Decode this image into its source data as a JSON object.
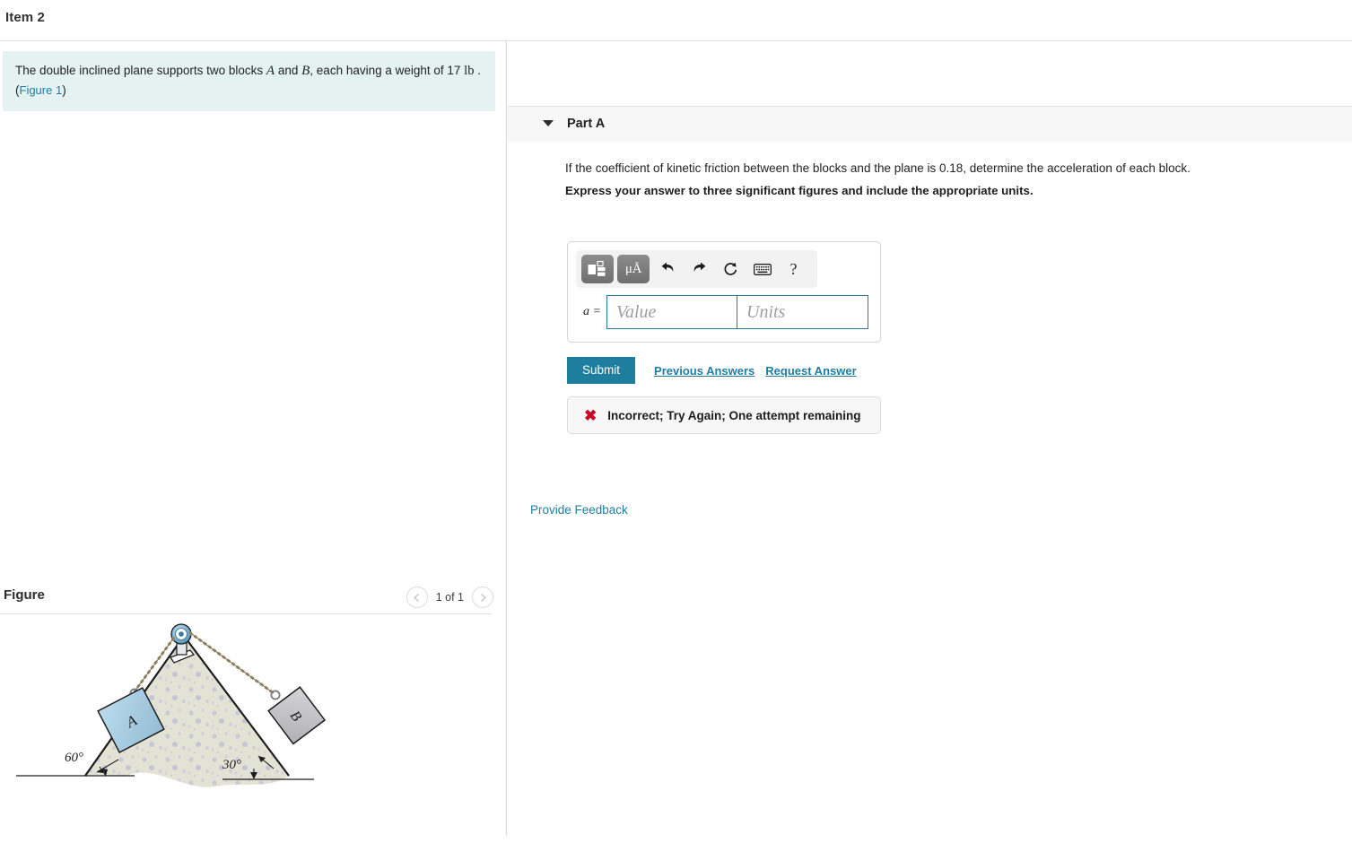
{
  "header": {
    "item_title": "Item 2"
  },
  "statement": {
    "text_part1": "The double inclined plane supports two blocks ",
    "var_a": "A",
    "text_and": " and ",
    "var_b": "B",
    "text_part2": ", each having a weight of 17 ",
    "unit": "lb",
    "text_end": " .",
    "figure_link_open": "(",
    "figure_link": "Figure 1",
    "figure_link_close": ")",
    "background_color": "#e4f2f2"
  },
  "figure": {
    "label": "Figure",
    "count": "1 of 1",
    "prev_icon": "chevron-left-icon",
    "next_icon": "chevron-right-icon",
    "diagram": {
      "block_a_label": "A",
      "block_b_label": "B",
      "angle_left": "60°",
      "angle_right": "30°",
      "block_a_color": "#a8cde1",
      "block_b_color": "#c2c2c7",
      "wedge_color": "#e2e2d4",
      "pulley_color": "#6aa3c4"
    }
  },
  "part_a": {
    "caret_icon": "chevron-down-icon",
    "title": "Part A",
    "question": "If the coefficient of kinetic friction between the blocks and the plane is 0.18, determine the acceleration of each block.",
    "express": "Express your answer to three significant figures and include the appropriate units.",
    "toolbar": {
      "template_icon": "math-template-icon",
      "units_icon": "micro-angstrom-icon",
      "undo_icon": "undo-arrow-icon",
      "redo_icon": "redo-arrow-icon",
      "reset_icon": "reset-circle-icon",
      "keyboard_icon": "keyboard-icon",
      "help_icon": "question-mark-icon",
      "help_label": "?",
      "units_label": "μÅ"
    },
    "answer": {
      "variable_label": "a =",
      "value_placeholder": "Value",
      "units_placeholder": "Units",
      "value": "",
      "units": "",
      "field_border_color": "#2b7c94"
    },
    "submit_label": "Submit",
    "previous_answers_label": "Previous Answers",
    "request_answer_label": "Request Answer",
    "submit_color": "#1d7e9e",
    "feedback": {
      "icon": "red-x-icon",
      "icon_glyph": "✖",
      "message": "Incorrect; Try Again; One attempt remaining",
      "icon_color": "#cc0022"
    }
  },
  "footer": {
    "provide_feedback_label": "Provide Feedback",
    "link_color": "#1f7ea1"
  }
}
